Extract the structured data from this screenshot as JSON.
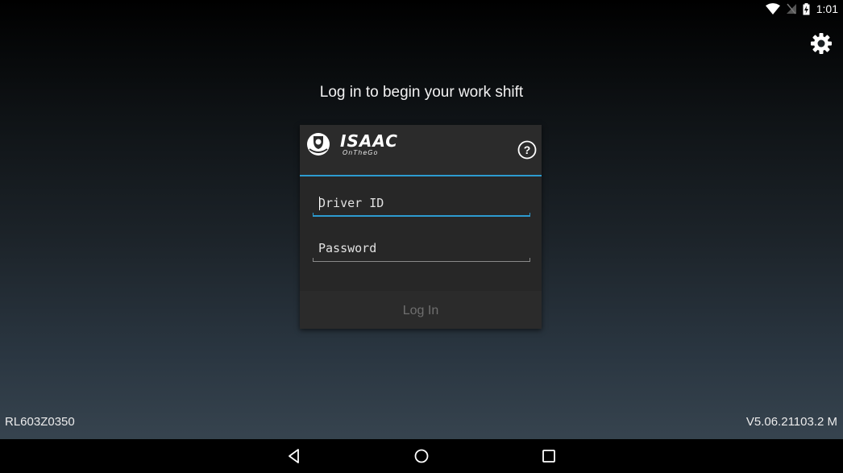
{
  "status_bar": {
    "time": "1:01",
    "icons": [
      "wifi-icon",
      "no-signal-icon",
      "battery-charging-icon"
    ]
  },
  "settings": {
    "icon": "gear-icon"
  },
  "headline": "Log in to begin your work shift",
  "login_card": {
    "logo": {
      "title": "ISAAC",
      "subtitle": "OnTheGo"
    },
    "help_icon": "help-circle-icon",
    "driver_id": {
      "placeholder": "Driver ID",
      "value": ""
    },
    "password": {
      "placeholder": "Password",
      "value": ""
    },
    "login_button": "Log In"
  },
  "footer": {
    "device_id": "RL603Z0350",
    "version": "V5.06.21103.2 M"
  },
  "nav_bar": {
    "buttons": [
      "back-icon",
      "home-icon",
      "recents-icon"
    ]
  },
  "colors": {
    "accent": "#2d9bd0",
    "card_bg": "#272727",
    "disabled_text": "#6f6f6f"
  }
}
